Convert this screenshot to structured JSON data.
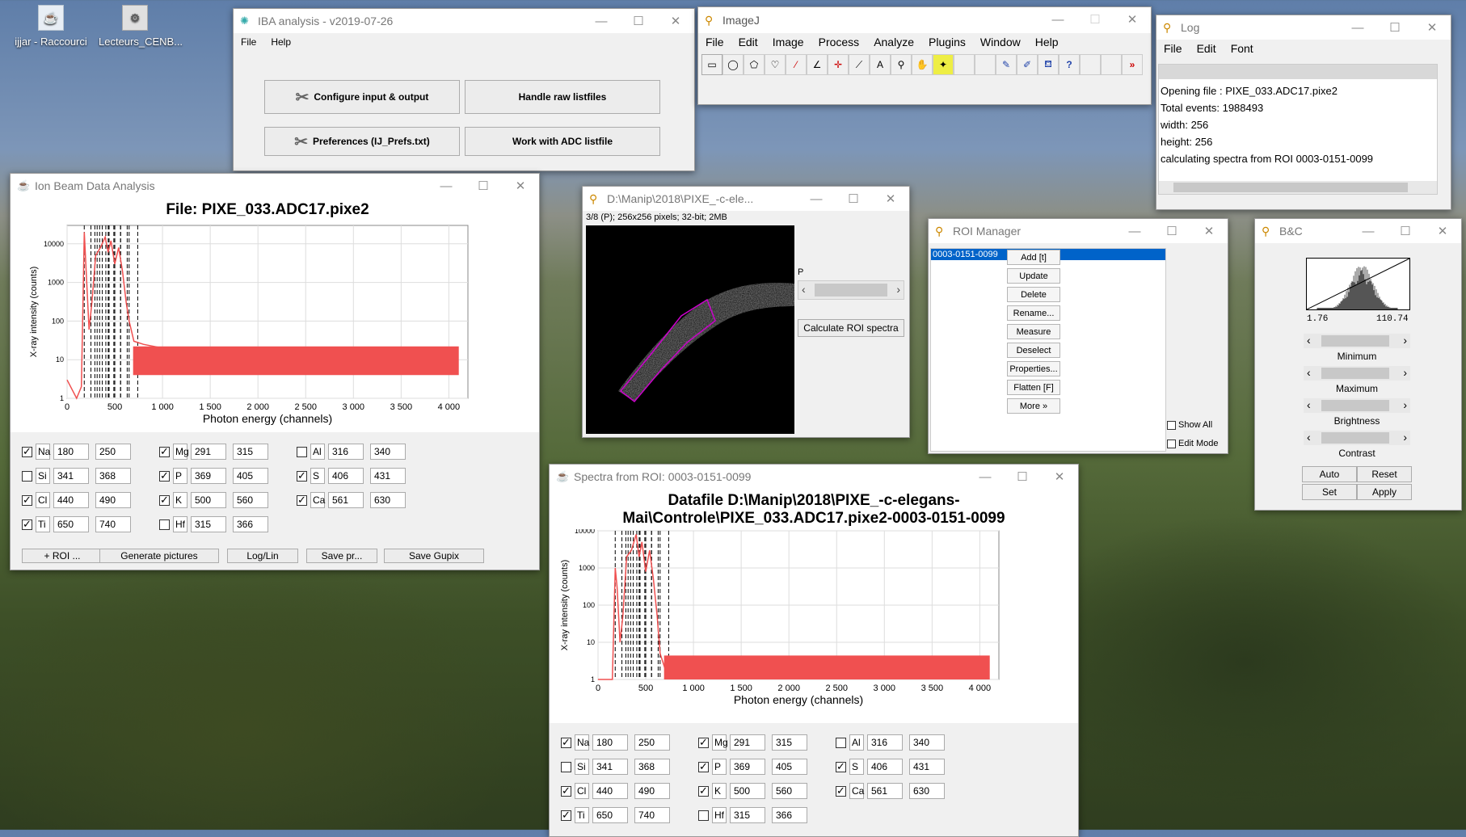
{
  "desktop": {
    "icons": [
      {
        "label": "ijjar - Raccourci"
      },
      {
        "label": "Lecteurs_CENB..."
      }
    ]
  },
  "window_controls": {
    "min": "—",
    "max": "☐",
    "close": "✕"
  },
  "iba": {
    "title": "IBA analysis - v2019-07-26",
    "menu": [
      "File",
      "Help"
    ],
    "buttons": {
      "configure": "Configure input & output",
      "raw": "Handle raw listfiles",
      "prefs": "Preferences (IJ_Prefs.txt)",
      "adc": "Work with ADC listfile"
    }
  },
  "imagej": {
    "title": "ImageJ",
    "menu": [
      "File",
      "Edit",
      "Image",
      "Process",
      "Analyze",
      "Plugins",
      "Window",
      "Help"
    ]
  },
  "log": {
    "title": "Log",
    "menu": [
      "File",
      "Edit",
      "Font"
    ],
    "lines": [
      "Opening file : PIXE_033.ADC17.pixe2",
      "Total events: 1988493",
      "width: 256",
      "height: 256",
      "calculating spectra from ROI 0003-0151-0099"
    ]
  },
  "ionbeam": {
    "title": "Ion Beam Data Analysis",
    "file_label": "File: PIXE_033.ADC17.pixe2",
    "buttons": {
      "roi": "+ ROI ...",
      "generate": "Generate pictures",
      "loglin": "Log/Lin",
      "save_pr": "Save pr...",
      "save_gupix": "Save Gupix"
    }
  },
  "elements": [
    {
      "name": "Na",
      "checked": true,
      "min": "180",
      "max": "250"
    },
    {
      "name": "Mg",
      "checked": true,
      "min": "291",
      "max": "315"
    },
    {
      "name": "Al",
      "checked": false,
      "min": "316",
      "max": "340"
    },
    {
      "name": "Si",
      "checked": false,
      "min": "341",
      "max": "368"
    },
    {
      "name": "P",
      "checked": true,
      "min": "369",
      "max": "405"
    },
    {
      "name": "S",
      "checked": true,
      "min": "406",
      "max": "431"
    },
    {
      "name": "Cl",
      "checked": true,
      "min": "440",
      "max": "490"
    },
    {
      "name": "K",
      "checked": true,
      "min": "500",
      "max": "560"
    },
    {
      "name": "Ca",
      "checked": true,
      "min": "561",
      "max": "630"
    },
    {
      "name": "Ti",
      "checked": true,
      "min": "650",
      "max": "740"
    },
    {
      "name": "Hf",
      "checked": false,
      "min": "315",
      "max": "366"
    }
  ],
  "image": {
    "title": "D:\\Manip\\2018\\PIXE_-c-ele...",
    "info": "3/8 (P); 256x256 pixels; 32-bit; 2MB",
    "slider_label": "P",
    "calc_button": "Calculate ROI spectra"
  },
  "roi_manager": {
    "title": "ROI Manager",
    "selected": "0003-0151-0099",
    "buttons": [
      "Add [t]",
      "Update",
      "Delete",
      "Rename...",
      "Measure",
      "Deselect",
      "Properties...",
      "Flatten [F]",
      "More »"
    ],
    "checks": [
      "Show All",
      "Edit Mode"
    ]
  },
  "bc": {
    "title": "B&C",
    "min_val": "1.76",
    "max_val": "110.74",
    "labels": [
      "Minimum",
      "Maximum",
      "Brightness",
      "Contrast"
    ],
    "buttons": [
      "Auto",
      "Reset",
      "Set",
      "Apply"
    ]
  },
  "spectra": {
    "title": "Spectra from ROI: 0003-0151-0099",
    "heading1": "Datafile D:\\Manip\\2018\\PIXE_-c-elegans-",
    "heading2": "Mai\\Controle\\PIXE_033.ADC17.pixe2-0003-0151-0099"
  },
  "chart_data": [
    {
      "type": "line",
      "title": "File: PIXE_033.ADC17.pixe2",
      "xlabel": "Photon energy (channels)",
      "ylabel": "X-ray intensity (counts)",
      "xlim": [
        0,
        4200
      ],
      "ylim": [
        1,
        30000
      ],
      "yscale": "log",
      "grid": true,
      "x_ticks": [
        "0",
        "500",
        "1 000",
        "1 500",
        "2 000",
        "2 500",
        "3 000",
        "3 500",
        "4 000"
      ],
      "y_ticks": [
        "1",
        "10",
        "100",
        "1000",
        "10000"
      ],
      "x": [
        0,
        100,
        150,
        180,
        200,
        230,
        260,
        300,
        350,
        400,
        430,
        460,
        500,
        540,
        580,
        620,
        650,
        700,
        800,
        1000,
        1500,
        2000,
        2500,
        3000,
        3500,
        4000,
        4100
      ],
      "y": [
        3,
        1,
        2,
        20000,
        2000,
        60,
        300,
        5000,
        8000,
        15000,
        6000,
        12000,
        3000,
        8000,
        2000,
        300,
        100,
        30,
        25,
        20,
        15,
        14,
        12,
        12,
        12,
        11,
        10
      ],
      "markers": [
        180,
        250,
        291,
        315,
        341,
        369,
        406,
        431,
        440,
        490,
        500,
        560,
        561,
        630,
        650,
        740
      ]
    },
    {
      "type": "line",
      "xlabel": "Photon energy (channels)",
      "ylabel": "X-ray intensity (counts)",
      "xlim": [
        0,
        4200
      ],
      "ylim": [
        1,
        10000
      ],
      "yscale": "log",
      "grid": true,
      "x_ticks": [
        "0",
        "500",
        "1 000",
        "1 500",
        "2 000",
        "2 500",
        "3 000",
        "3 500",
        "4 000"
      ],
      "y_ticks": [
        "1",
        "10",
        "100",
        "1000",
        "10000"
      ],
      "x": [
        0,
        100,
        150,
        180,
        200,
        230,
        260,
        300,
        350,
        400,
        430,
        460,
        500,
        540,
        580,
        620,
        650,
        700,
        800,
        1000,
        1500,
        2000,
        2500,
        3000,
        3500,
        4000,
        4100
      ],
      "y": [
        1,
        1,
        1,
        1000,
        300,
        10,
        50,
        2000,
        3000,
        8000,
        2000,
        5000,
        800,
        3000,
        500,
        50,
        5,
        2,
        2,
        2,
        2,
        2,
        2,
        2,
        2,
        2,
        2
      ],
      "markers": [
        180,
        250,
        291,
        315,
        341,
        369,
        406,
        431,
        440,
        490,
        500,
        560,
        561,
        630,
        650,
        740
      ]
    }
  ]
}
